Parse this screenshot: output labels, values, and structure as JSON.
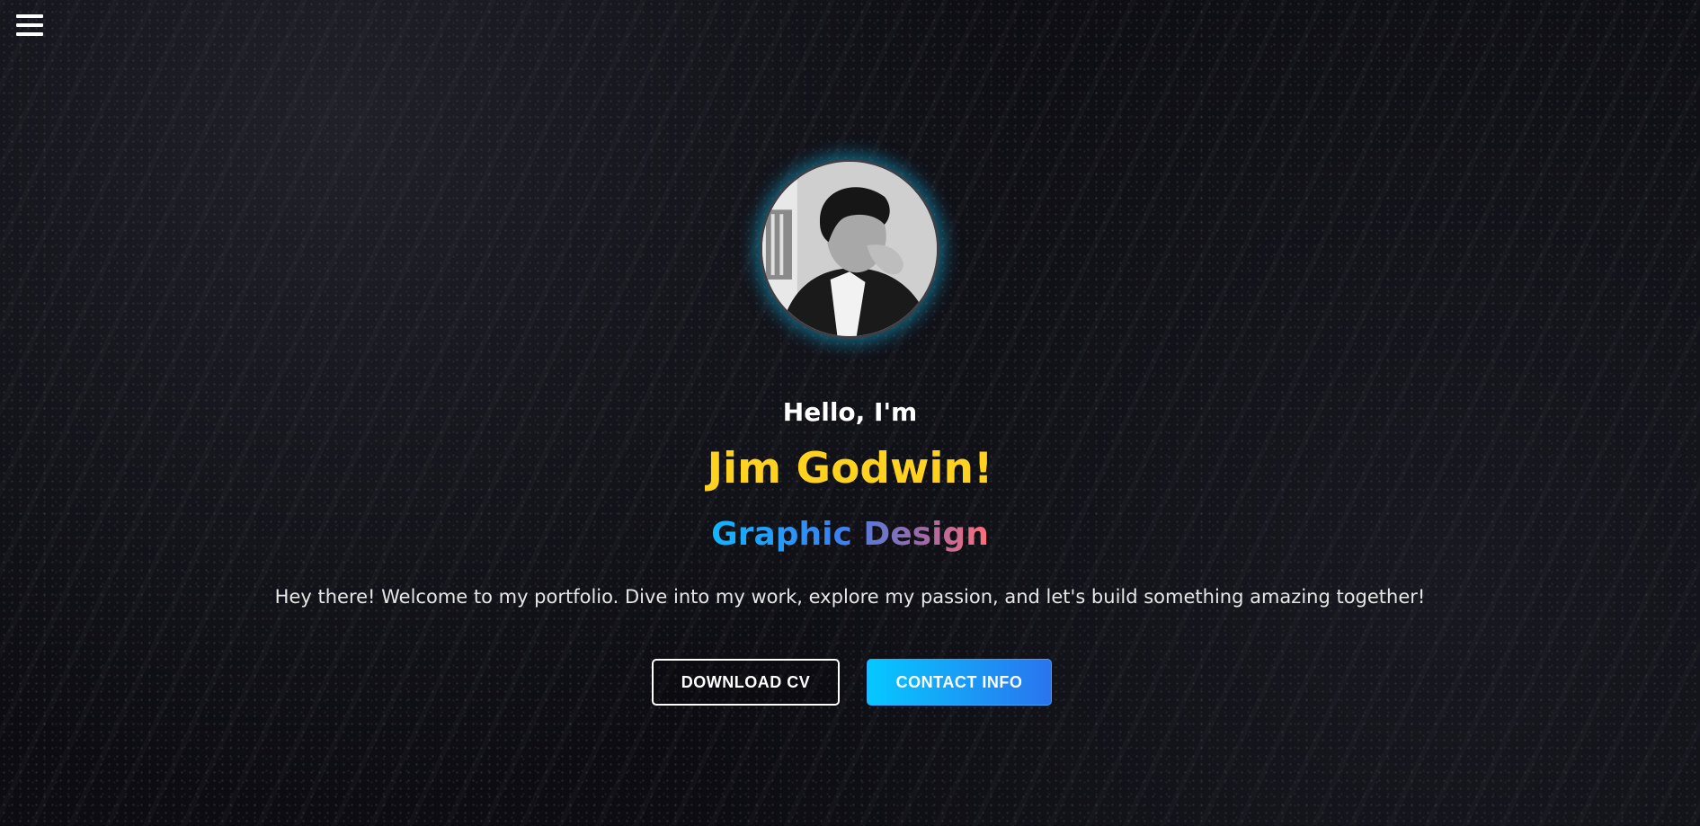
{
  "nav": {
    "menu_icon": "hamburger-menu-icon"
  },
  "hero": {
    "avatar_alt": "profile-photo",
    "greeting": "Hello, I'm",
    "name": "Jim Godwin!",
    "role": "Graphic Design",
    "intro": "Hey there! Welcome to my portfolio. Dive into my work, explore my passion, and let's build something amazing together!"
  },
  "actions": {
    "download_cv_label": "DOWNLOAD CV",
    "contact_info_label": "CONTACT INFO"
  },
  "colors": {
    "background": "#0c0c12",
    "name_accent": "#ffd21f",
    "role_gradient_start": "#10b6ff",
    "role_gradient_end": "#ff6f7a",
    "avatar_glow": "#10a0c8",
    "contact_button_start": "#06c8ff",
    "contact_button_end": "#2a74ee"
  }
}
